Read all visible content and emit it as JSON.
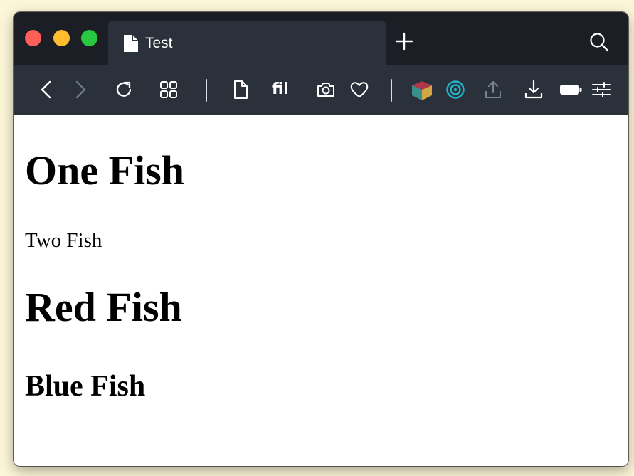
{
  "browser": {
    "tab_title": "Test",
    "toolbar": {
      "visible_text": "fil"
    },
    "icons": {
      "traffic_lights": [
        "close",
        "minimize",
        "zoom"
      ],
      "titlebar": [
        "file-icon",
        "plus-icon",
        "search-icon"
      ],
      "toolbar": [
        "chevron-left-icon",
        "chevron-right-icon",
        "reload-icon",
        "grid-icon",
        "file-icon",
        "camera-icon",
        "heart-icon",
        "cube-icon",
        "circle-target-icon",
        "share-icon",
        "download-icon",
        "battery-icon",
        "sliders-icon"
      ]
    },
    "colors": {
      "titlebar_bg": "#1b1f25",
      "toolbar_bg": "#2a313a",
      "close": "#fe5f57",
      "minimize": "#febc2e",
      "zoom": "#28c840",
      "accent_teal": "#22b3c7"
    }
  },
  "page": {
    "heading_one": "One Fish",
    "paragraph": "Two Fish",
    "heading_two": "Red Fish",
    "heading_three": "Blue Fish"
  }
}
